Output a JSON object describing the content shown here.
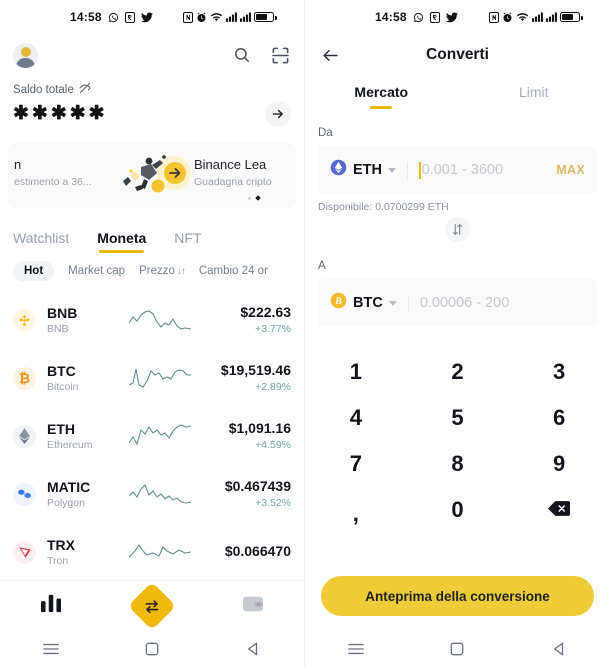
{
  "status_bar": {
    "time": "14:58",
    "left_icons": [
      "whatsapp-icon",
      "app-icon",
      "twitter-icon"
    ],
    "right_icons": [
      "nfc-icon",
      "alarm-icon",
      "wifi-icon",
      "signal-1-icon",
      "signal-2-icon",
      "battery-icon"
    ]
  },
  "colors": {
    "accent": "#f0b90b",
    "cta": "#f0cb38",
    "positive": "#6ea9a7",
    "text": "#12161c",
    "muted": "#9aa1ac",
    "field_bg": "#fafafa"
  },
  "left_screen": {
    "header": {
      "avatar": "user-avatar",
      "search_icon": "search-icon",
      "scan_icon": "scan-icon"
    },
    "balance": {
      "label": "Saldo totale",
      "hidden_icon": "eye-off-icon",
      "amount": "✱✱✱✱✱",
      "arrow_icon": "arrow-right-icon"
    },
    "banner": {
      "left_title": "n",
      "left_sub": "estimento a 36...",
      "right_title": "Binance Lea",
      "right_sub": "Guadagna cripto",
      "dots_total": 2,
      "dots_active_index": 1
    },
    "tabs": [
      {
        "label": "Watchlist",
        "active": false
      },
      {
        "label": "Moneta",
        "active": true
      },
      {
        "label": "NFT",
        "active": false
      }
    ],
    "filter_chips": [
      {
        "label": "Hot",
        "active": true,
        "sort": ""
      },
      {
        "label": "Market cap",
        "active": false,
        "sort": ""
      },
      {
        "label": "Prezzo",
        "active": false,
        "sort": "↓↑"
      },
      {
        "label": "Cambio 24 or",
        "active": false,
        "sort": ""
      }
    ],
    "coins": [
      {
        "symbol": "BNB",
        "name": "BNB",
        "price": "$222.63",
        "change": "+3.77%",
        "icon_name": "bnb-icon",
        "icon_bg": "#fdf6e3",
        "icon_color": "#f0b90b",
        "spark": "0,18 4,12 8,16 12,10 16,7 20,6 24,9 28,17 32,22 36,18 40,20 44,14 48,21 52,24 56,23 62,24"
      },
      {
        "symbol": "BTC",
        "name": "Bitcoin",
        "price": "$19,519.46",
        "change": "+2.89%",
        "icon_name": "btc-icon",
        "icon_bg": "#fdf3e0",
        "icon_color": "#f7931a",
        "spark": "0,22 4,20 7,6 10,22 14,24 18,18 22,8 26,12 30,10 34,16 38,14 42,16 46,9 50,7 54,8 58,12 62,12"
      },
      {
        "symbol": "ETH",
        "name": "Ethereum",
        "price": "$1,091.16",
        "change": "+4.59%",
        "icon_name": "eth-icon",
        "icon_bg": "#f2f3f5",
        "icon_color": "#7b8497",
        "spark": "0,22 4,16 8,23 12,9 16,13 20,6 24,12 28,9 32,14 36,12 40,17 44,10 48,6 52,4 57,6 62,5"
      },
      {
        "symbol": "MATIC",
        "name": "Polygon",
        "price": "$0.467439",
        "change": "+3.52%",
        "icon_name": "matic-icon",
        "icon_bg": "#eef4ff",
        "icon_color": "#2f7ef0",
        "spark": "0,17 4,13 8,18 12,10 16,6 20,16 24,12 28,18 32,15 36,20 40,17 44,21 48,19 52,23 57,24 62,23"
      },
      {
        "symbol": "TRX",
        "name": "Tron",
        "price": "$0.066470",
        "change": "",
        "icon_name": "trx-icon",
        "icon_bg": "#fdeef0",
        "icon_color": "#eb3c4f",
        "spark": "0,20 6,14 10,8 14,14 18,18 24,16 30,19 34,10 38,14 44,17 50,13 56,16 62,15"
      }
    ],
    "bottom_nav": [
      {
        "name": "markets-nav",
        "icon": "bar-chart-icon",
        "active": true
      },
      {
        "name": "trade-nav",
        "icon": "swap-icon",
        "active": true
      },
      {
        "name": "wallet-nav",
        "icon": "wallet-icon",
        "active": false
      }
    ]
  },
  "right_screen": {
    "header": {
      "back_icon": "back-arrow-icon",
      "title": "Converti"
    },
    "tabs": [
      {
        "label": "Mercato",
        "active": true
      },
      {
        "label": "Limit",
        "active": false
      }
    ],
    "from": {
      "label": "Da",
      "coin": "ETH",
      "coin_icon": "eth-icon",
      "placeholder": "0.001 - 3600",
      "value": "",
      "max_label": "MAX",
      "available": "Disponibile: 0.0700299 ETH"
    },
    "swap_icon": "swap-vertical-icon",
    "to": {
      "label": "A",
      "coin": "BTC",
      "coin_icon": "btc-icon",
      "placeholder": "0.00006 - 200",
      "value": ""
    },
    "keypad": [
      "1",
      "2",
      "3",
      "4",
      "5",
      "6",
      "7",
      "8",
      "9",
      ",",
      "0",
      "backspace"
    ],
    "cta_label": "Anteprima della conversione"
  },
  "android_nav": {
    "menu_icon": "menu-icon",
    "home_icon": "home-square-icon",
    "back_icon": "back-triangle-icon"
  }
}
